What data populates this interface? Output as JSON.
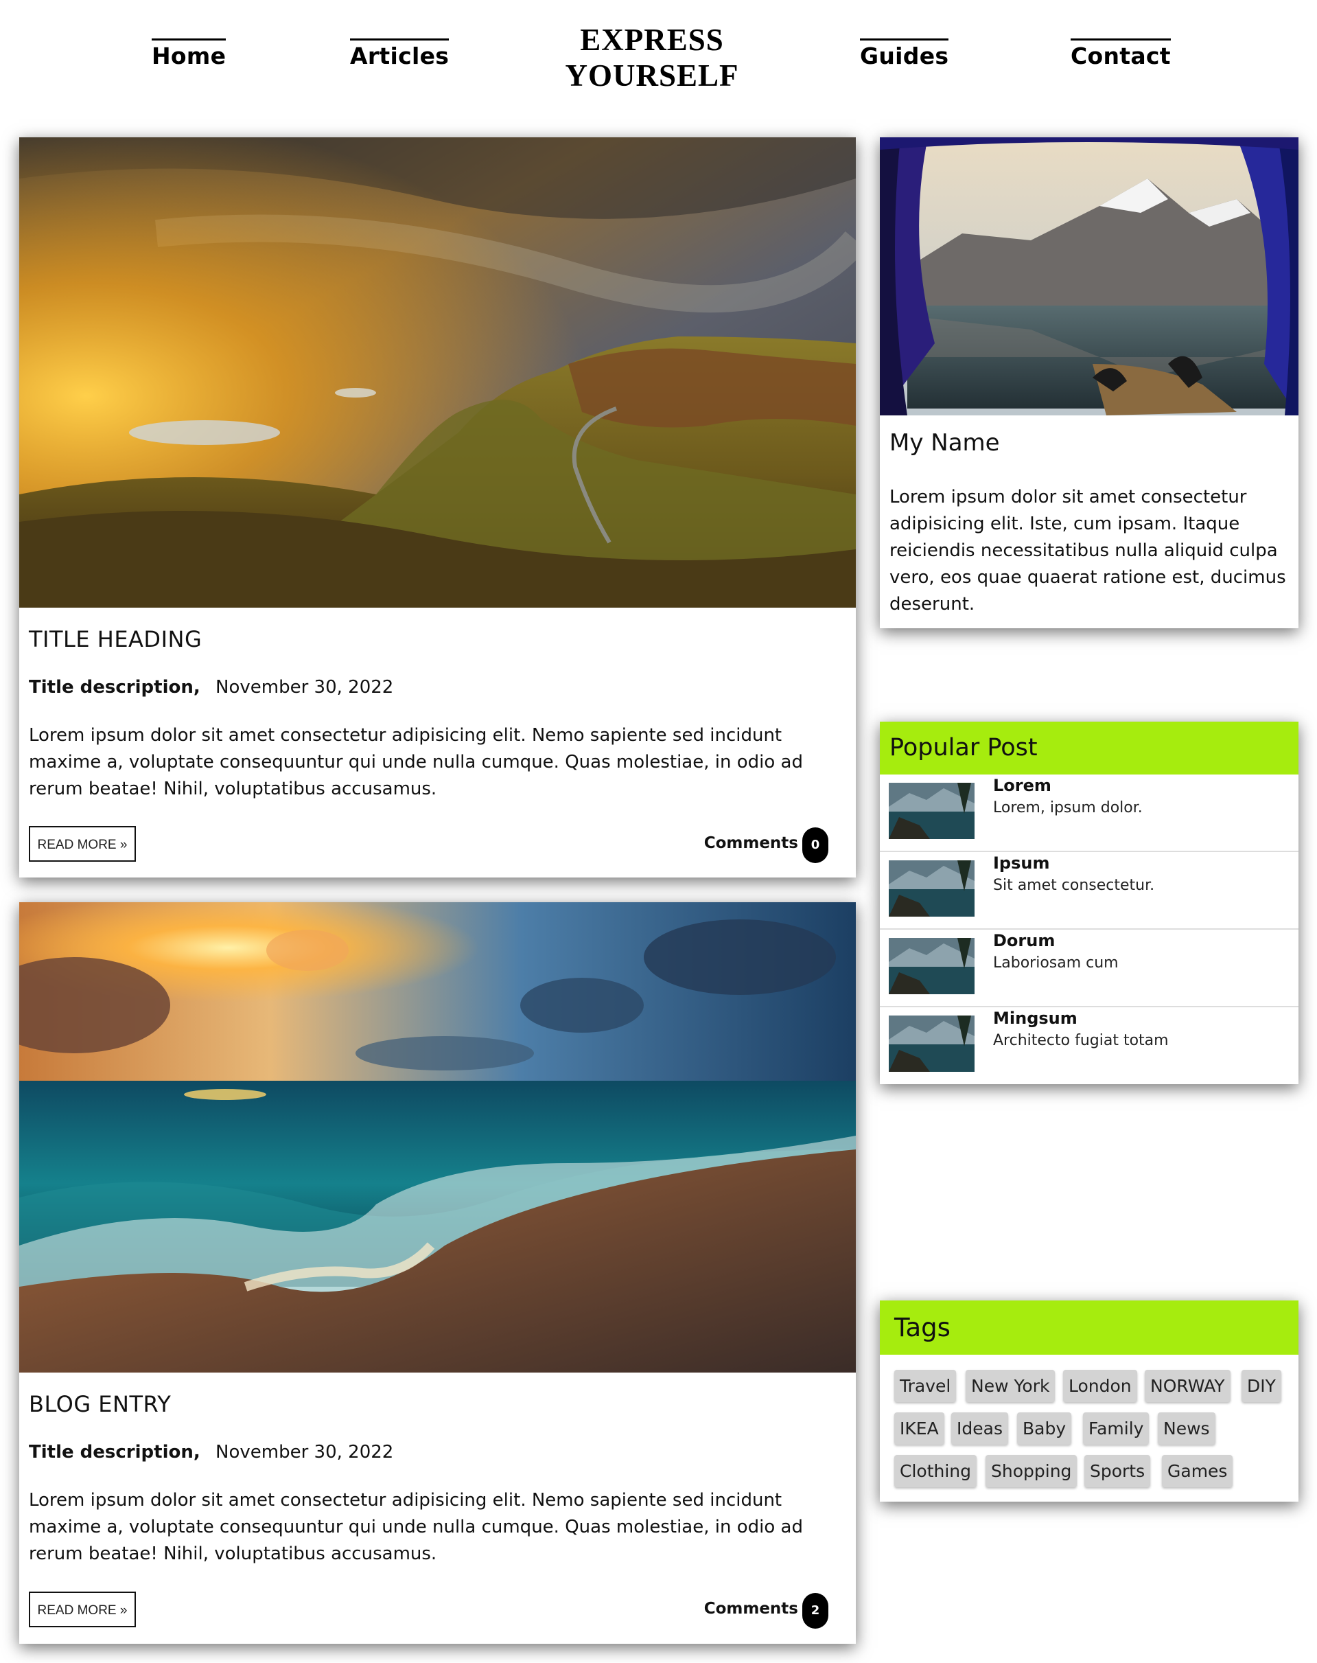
{
  "nav": {
    "home": "Home",
    "articles": "Articles",
    "brand_line1": "EXPRESS",
    "brand_line2": "YOURSELF",
    "guides": "Guides",
    "contact": "Contact"
  },
  "posts": [
    {
      "title": "TITLE HEADING",
      "desc_label": "Title description,",
      "date": "November 30, 2022",
      "text": "Lorem ipsum dolor sit amet consectetur adipisicing elit. Nemo sapiente sed incidunt maxime a, voluptate consequuntur qui unde nulla cumque. Quas molestiae, in odio ad rerum beatae! Nihil, voluptatibus accusamus.",
      "read_more": "READ MORE »",
      "comments_label": "Comments",
      "comments_count": "0"
    },
    {
      "title": "BLOG ENTRY",
      "desc_label": "Title description,",
      "date": "November 30, 2022",
      "text": "Lorem ipsum dolor sit amet consectetur adipisicing elit. Nemo sapiente sed incidunt maxime a, voluptate consequuntur qui unde nulla cumque. Quas molestiae, in odio ad rerum beatae! Nihil, voluptatibus accusamus.",
      "read_more": "READ MORE »",
      "comments_label": "Comments",
      "comments_count": "2"
    }
  ],
  "profile": {
    "name": "My Name",
    "text": "Lorem ipsum dolor sit amet consectetur adipisicing elit. Iste, cum ipsam. Itaque reiciendis necessitatibus nulla aliquid culpa vero, eos quae quaerat ratione est, ducimus deserunt."
  },
  "popular": {
    "heading": "Popular Post",
    "items": [
      {
        "title": "Lorem",
        "subtitle": "Lorem, ipsum dolor."
      },
      {
        "title": "Ipsum",
        "subtitle": "Sit amet consectetur."
      },
      {
        "title": "Dorum",
        "subtitle": "Laboriosam cum"
      },
      {
        "title": "Mingsum",
        "subtitle": "Architecto fugiat totam"
      }
    ]
  },
  "tags": {
    "heading": "Tags",
    "items": [
      "Travel",
      "New York",
      "London",
      "NORWAY",
      "DIY",
      "IKEA",
      "Ideas",
      "Baby",
      "Family",
      "News",
      "Clothing",
      "Shopping",
      "Sports",
      "Games"
    ]
  },
  "colors": {
    "accent": "#a6ec0e",
    "badge": "#000000",
    "tag_bg": "#d3d3d3"
  }
}
